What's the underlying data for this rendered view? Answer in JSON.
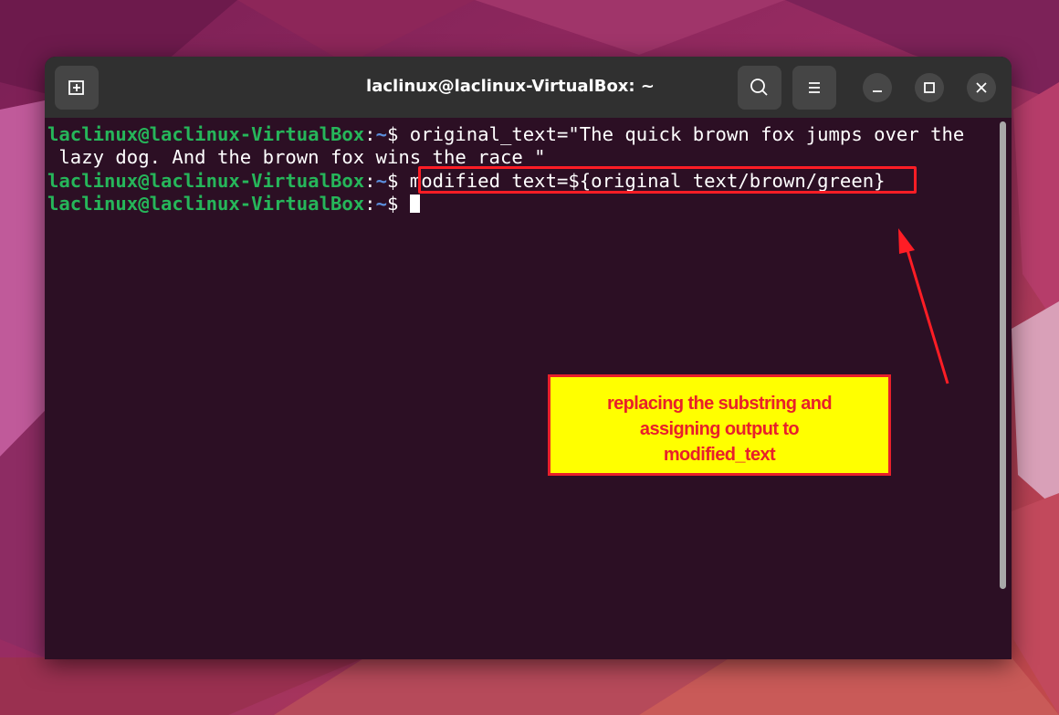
{
  "window": {
    "title": "laclinux@laclinux-VirtualBox: ~",
    "new_tab_icon": "new-tab-icon",
    "search_icon": "search-icon",
    "menu_icon": "hamburger-menu-icon",
    "minimize_icon": "minimize-icon",
    "maximize_icon": "maximize-icon",
    "close_icon": "close-icon"
  },
  "terminal": {
    "prompt_user_host": "laclinux@laclinux-VirtualBox",
    "prompt_colon": ":",
    "prompt_path": "~",
    "prompt_dollar": "$",
    "lines": [
      {
        "cmd": " original_text=\"The quick brown fox jumps over the"
      },
      {
        "cont": " lazy dog. And the brown fox wins the race \""
      },
      {
        "cmd": " modified_text=${original_text/brown/green}"
      },
      {
        "cmd": " "
      }
    ]
  },
  "annotation": {
    "text_line1": "replacing the substring and",
    "text_line2": "assigning output to",
    "text_line3": "modified_text"
  },
  "colors": {
    "terminal_bg": "#2c0f24",
    "titlebar_bg": "#303030",
    "prompt_green": "#26b65a",
    "prompt_blue": "#5c8fdd",
    "annotation_red": "#e8202a",
    "annotation_yellow": "#ffff00"
  }
}
